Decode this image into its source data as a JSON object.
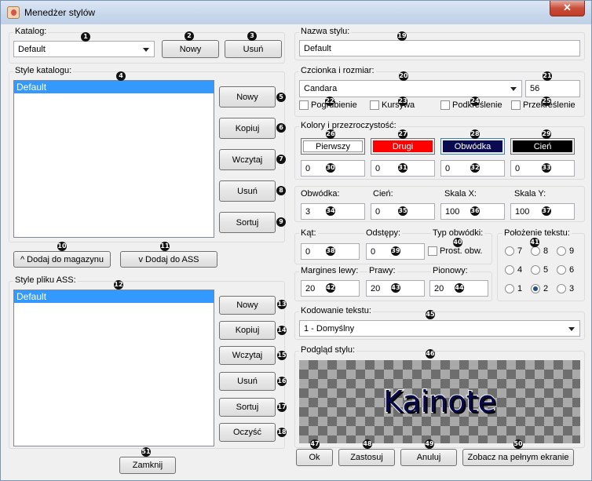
{
  "window": {
    "title": "Menedżer stylów",
    "close": "✕"
  },
  "catalog": {
    "label": "Katalog:",
    "value": "Default",
    "new_btn": "Nowy",
    "delete_btn": "Usuń"
  },
  "catalog_styles": {
    "label": "Style katalogu:",
    "items": [
      "Default"
    ],
    "buttons": [
      "Nowy",
      "Kopiuj",
      "Wczytaj",
      "Usuń",
      "Sortuj"
    ]
  },
  "transfer": {
    "add_to_store": "^ Dodaj do magazynu",
    "add_to_ass": "v Dodaj do ASS"
  },
  "ass_styles": {
    "label": "Style pliku ASS:",
    "items": [
      "Default"
    ],
    "buttons": [
      "Nowy",
      "Kopiuj",
      "Wczytaj",
      "Usuń",
      "Sortuj",
      "Oczyść"
    ]
  },
  "close_btn": "Zamknij",
  "style_name": {
    "label": "Nazwa stylu:",
    "value": "Default"
  },
  "font": {
    "label": "Czcionka i rozmiar:",
    "family": "Candara",
    "size": "56",
    "bold": "Pogrubienie",
    "italic": "Kursywa",
    "underline": "Podkreślenie",
    "strike": "Przekreślenie"
  },
  "colors": {
    "label": "Kolory i przezroczystość:",
    "primary": {
      "label": "Pierwszy",
      "alpha": "0",
      "bg": "#ffffff",
      "fg": "#000000"
    },
    "secondary": {
      "label": "Drugi",
      "alpha": "0",
      "bg": "#ff0000",
      "fg": "#ffffff"
    },
    "outline": {
      "label": "Obwódka",
      "alpha": "0",
      "bg": "#0a0a50",
      "fg": "#ffffff"
    },
    "shadow": {
      "label": "Cień",
      "alpha": "0",
      "bg": "#000000",
      "fg": "#ffffff"
    }
  },
  "metrics": {
    "outline_label": "Obwódka:",
    "outline": "3",
    "shadow_label": "Cień:",
    "shadow": "0",
    "scale_x_label": "Skala X:",
    "scale_x": "100",
    "scale_y_label": "Skala Y:",
    "scale_y": "100"
  },
  "misc": {
    "angle_label": "Kąt:",
    "angle": "0",
    "spacing_label": "Odstępy:",
    "spacing": "0",
    "border_type_label": "Typ obwódki:",
    "opaque_box": "Prost. obw."
  },
  "margins": {
    "left_label": "Margines lewy:",
    "left": "20",
    "right_label": "Prawy:",
    "right": "20",
    "vertical_label": "Pionowy:",
    "vertical": "20"
  },
  "alignment": {
    "label": "Położenie tekstu:",
    "options": [
      "7",
      "8",
      "9",
      "4",
      "5",
      "6",
      "1",
      "2",
      "3"
    ],
    "selected": "2"
  },
  "encoding": {
    "label": "Kodowanie tekstu:",
    "value": "1 - Domyślny"
  },
  "preview": {
    "label": "Podgląd stylu:",
    "text": "Kainote"
  },
  "bottom": {
    "ok": "Ok",
    "apply": "Zastosuj",
    "cancel": "Anuluj",
    "fullscreen": "Zobacz na pełnym ekranie"
  },
  "markers": [
    "1",
    "2",
    "3",
    "4",
    "5",
    "6",
    "7",
    "8",
    "9",
    "10",
    "11",
    "12",
    "13",
    "14",
    "15",
    "16",
    "17",
    "18",
    "19",
    "20",
    "21",
    "22",
    "23",
    "24",
    "25",
    "26",
    "27",
    "28",
    "29",
    "30",
    "31",
    "32",
    "33",
    "34",
    "35",
    "36",
    "37",
    "38",
    "39",
    "40",
    "41",
    "42",
    "43",
    "44",
    "45",
    "46",
    "47",
    "48",
    "49",
    "50",
    "51"
  ]
}
